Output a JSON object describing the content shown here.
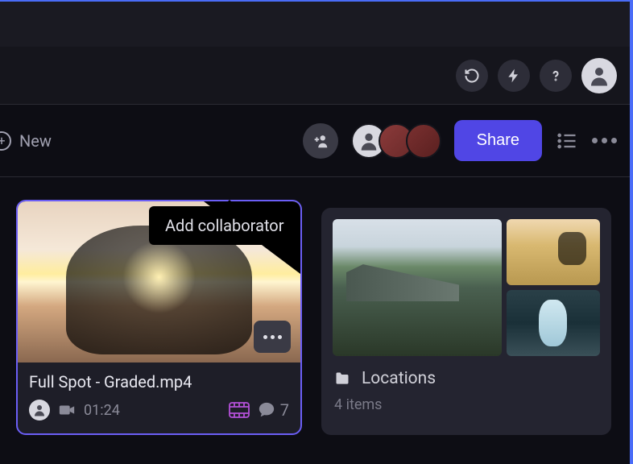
{
  "toolbar": {
    "new_label": "New",
    "share_label": "Share"
  },
  "tooltip": {
    "add_collaborator": "Add collaborator"
  },
  "video_card": {
    "title": "Full Spot - Graded.mp4",
    "duration": "01:24",
    "comment_count": "7"
  },
  "folder_card": {
    "title": "Locations",
    "subtitle": "4 items"
  }
}
